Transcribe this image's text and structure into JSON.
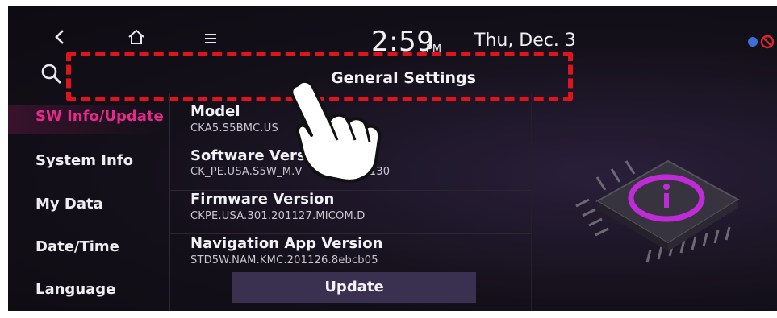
{
  "header": {
    "time": "2:59",
    "ampm": "PM",
    "date": "Thu, Dec. 3",
    "title": "General Settings"
  },
  "icons": {
    "back": "back-icon",
    "home": "home-icon",
    "menu": "menu-icon",
    "search": "search-icon",
    "chip": "chip-info-icon",
    "hand": "pointing-hand-icon"
  },
  "sidebar": {
    "items": [
      {
        "label": "SW Info/Update",
        "active": true
      },
      {
        "label": "System Info"
      },
      {
        "label": "My Data"
      },
      {
        "label": "Date/Time"
      },
      {
        "label": "Language"
      }
    ]
  },
  "info": {
    "model_label": "Model",
    "model_value": "CKA5.S5BMC.US",
    "software_label": "Software Vers",
    "software_value": "CK_PE.USA.S5W_M.V",
    "software_value_tail": "301.201130",
    "firmware_label": "Firmware Version",
    "firmware_value": "CKPE.USA.301.201127.MICOM.D",
    "nav_label": "Navigation App Version",
    "nav_value": "STD5W.NAM.KMC.201126.8ebcb05"
  },
  "actions": {
    "update_label": "Update"
  },
  "colors": {
    "accent_active": "#e52a8c",
    "highlight_box": "#e0141c",
    "background": "#141019",
    "button": "#3a3050",
    "chip_ring": "#c02bd8"
  }
}
